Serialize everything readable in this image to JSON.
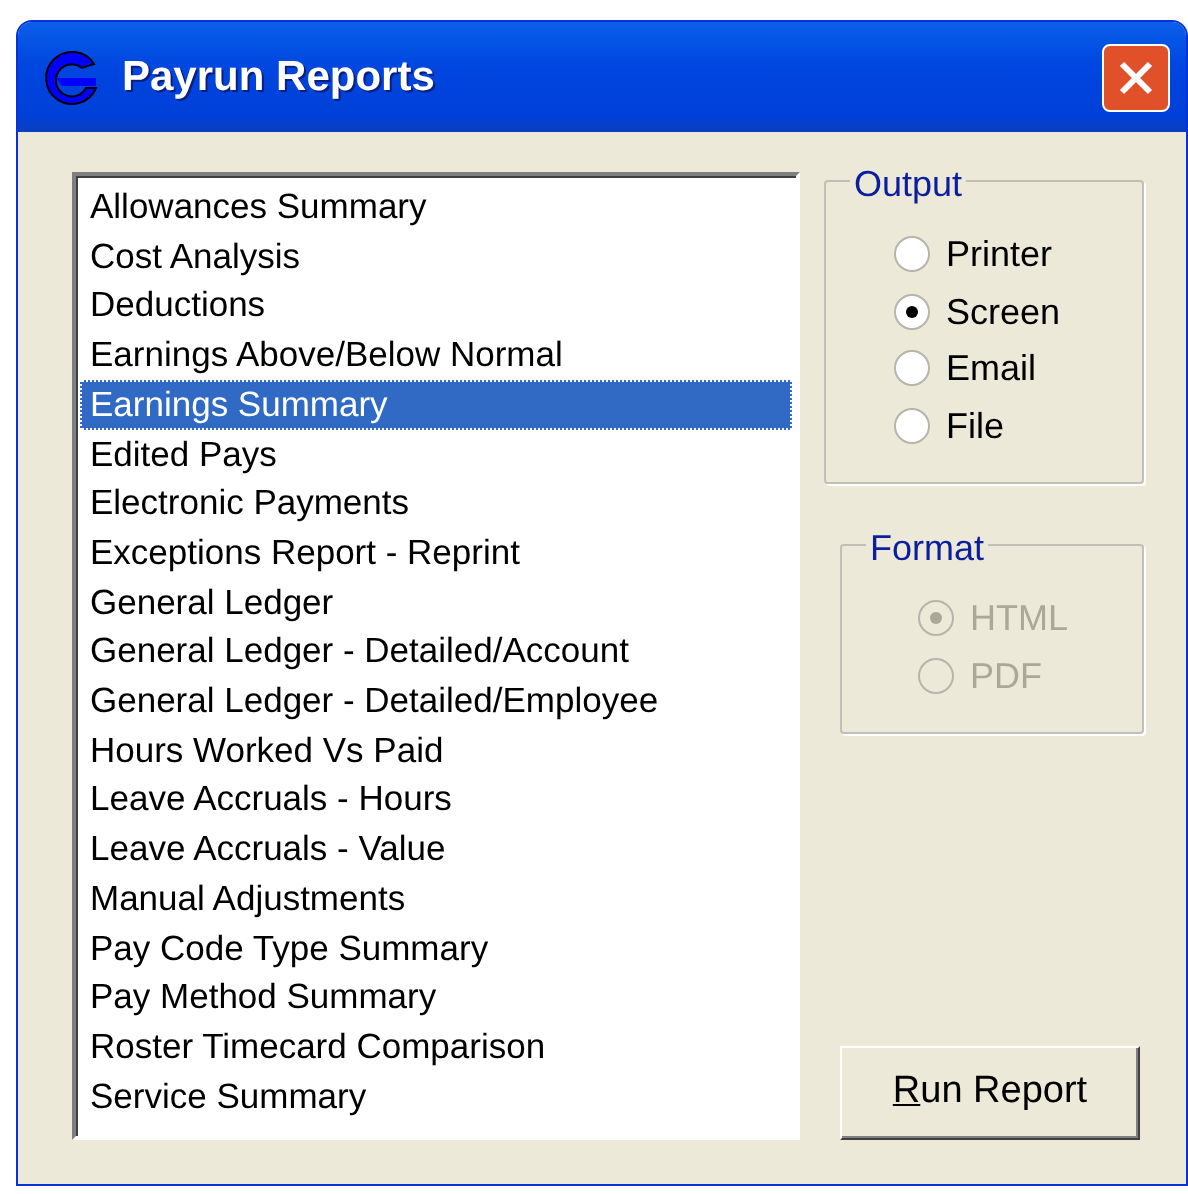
{
  "window": {
    "title": "Payrun Reports"
  },
  "reports": [
    {
      "label": "Allowances Summary",
      "selected": false
    },
    {
      "label": "Cost Analysis",
      "selected": false
    },
    {
      "label": "Deductions",
      "selected": false
    },
    {
      "label": "Earnings Above/Below Normal",
      "selected": false
    },
    {
      "label": "Earnings Summary",
      "selected": true
    },
    {
      "label": "Edited Pays",
      "selected": false
    },
    {
      "label": "Electronic Payments",
      "selected": false
    },
    {
      "label": "Exceptions Report - Reprint",
      "selected": false
    },
    {
      "label": "General Ledger",
      "selected": false
    },
    {
      "label": "General Ledger - Detailed/Account",
      "selected": false
    },
    {
      "label": "General Ledger - Detailed/Employee",
      "selected": false
    },
    {
      "label": "Hours Worked Vs Paid",
      "selected": false
    },
    {
      "label": "Leave Accruals - Hours",
      "selected": false
    },
    {
      "label": "Leave Accruals - Value",
      "selected": false
    },
    {
      "label": "Manual Adjustments",
      "selected": false
    },
    {
      "label": "Pay Code Type Summary",
      "selected": false
    },
    {
      "label": "Pay Method Summary",
      "selected": false
    },
    {
      "label": "Roster Timecard Comparison",
      "selected": false
    },
    {
      "label": "Service Summary",
      "selected": false
    }
  ],
  "output": {
    "title": "Output",
    "disabled": false,
    "options": [
      {
        "label": "Printer",
        "selected": false
      },
      {
        "label": "Screen",
        "selected": true
      },
      {
        "label": "Email",
        "selected": false
      },
      {
        "label": "File",
        "selected": false
      }
    ]
  },
  "format": {
    "title": "Format",
    "disabled": true,
    "options": [
      {
        "label": "HTML",
        "selected": true
      },
      {
        "label": "PDF",
        "selected": false
      }
    ]
  },
  "run_button": {
    "label": "Run Report"
  }
}
